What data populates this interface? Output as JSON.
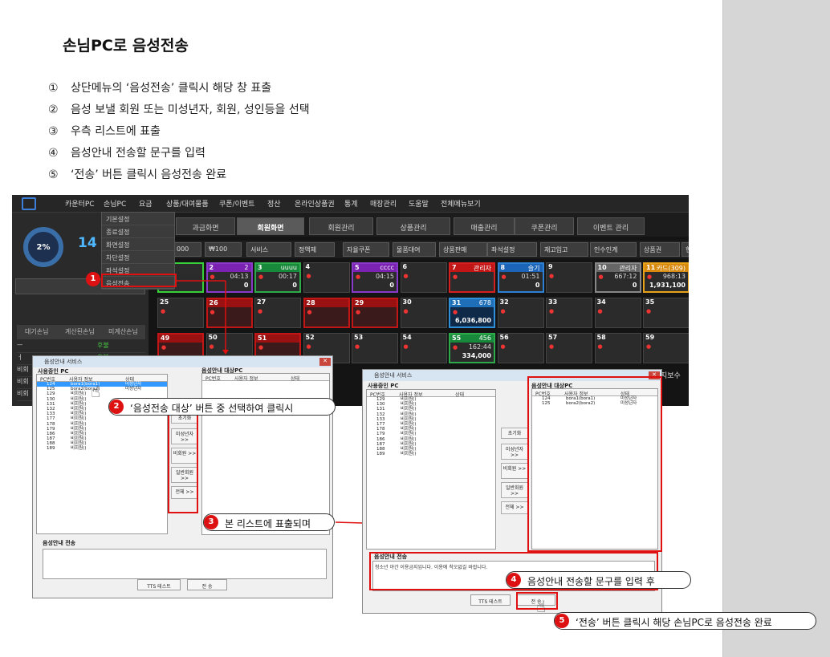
{
  "doc": {
    "title": "손님PC로 음성전송",
    "steps": [
      {
        "n": "①",
        "text": "상단메뉴의 ‘음성전송’ 클릭시 해당 창 표출"
      },
      {
        "n": "②",
        "text": "음성 보낼 회원 또는 미성년자, 회원, 성인등을 선택"
      },
      {
        "n": "③",
        "text": "우측 리스트에 표출"
      },
      {
        "n": "④",
        "text": "음성안내 전송할 문구를 입력"
      },
      {
        "n": "⑤",
        "text": "‘전송’ 버튼 클릭시 음성전송 완료"
      }
    ]
  },
  "app": {
    "menu": [
      "카운터PC",
      "손님PC",
      "요금",
      "상품/대여물품",
      "쿠폰/이벤트",
      "정산",
      "온라인상품권",
      "통계",
      "매장관리",
      "도움말",
      "전체메뉴보기"
    ],
    "submenu": [
      "기본설정",
      "종료설정",
      "화면설정",
      "차단설정",
      "좌석설정",
      "음성전송"
    ],
    "usage_percent": "2%",
    "seat_count": "14",
    "left_tabs": [
      "대기손님",
      "계산된손님",
      "미계산손님"
    ],
    "left_rows": [
      {
        "a": "ㅡ",
        "b": "후불"
      },
      {
        "a": "ㅓ",
        "b": "후불"
      },
      {
        "a": "비회",
        "b": "후불"
      },
      {
        "a": "비회",
        "b": "후불"
      },
      {
        "a": "비회",
        "b": ""
      }
    ],
    "top_tabs": [
      "과금화면",
      "회원화면",
      "회원관리",
      "상품관리",
      "매출관리",
      "쿠폰관리",
      "이벤트 관리"
    ],
    "tools": [
      "000",
      "₩100",
      "서비스",
      "정액제",
      "자율쿠폰",
      "물품대여",
      "상품판매",
      "좌석설정",
      "재고입고",
      "인수인계",
      "상품권",
      "현"
    ],
    "tiles": [
      {
        "num": "1",
        "name": "",
        "time": "",
        "big": "",
        "style": "green"
      },
      {
        "num": "2",
        "name": "2",
        "time": "04:13",
        "big": "0",
        "style": "purple"
      },
      {
        "num": "3",
        "name": "uuuu",
        "time": "00:17",
        "big": "0",
        "style": "green2"
      },
      {
        "num": "4",
        "name": "",
        "time": "",
        "big": "",
        "style": "plain"
      },
      {
        "num": "5",
        "name": "cccc",
        "time": "04:15",
        "big": "0",
        "style": "purple"
      },
      {
        "num": "6",
        "name": "",
        "time": "",
        "big": "",
        "style": "plain"
      },
      {
        "num": "7",
        "name": "관리자",
        "time": "",
        "big": "",
        "style": "red"
      },
      {
        "num": "8",
        "name": "슬기",
        "time": "01:51",
        "big": "0",
        "style": "blue"
      },
      {
        "num": "9",
        "name": "",
        "time": "",
        "big": "",
        "style": "plain"
      },
      {
        "num": "10",
        "name": "관리자",
        "time": "667:12",
        "big": "0",
        "style": "gray"
      },
      {
        "num": "11",
        "name": "카드(309)",
        "time": "968:13",
        "big": "1,931,100",
        "style": "orange"
      },
      {
        "num": "25",
        "name": "",
        "time": "",
        "big": "",
        "style": "plain"
      },
      {
        "num": "26",
        "name": "",
        "time": "",
        "big": "",
        "style": "redout"
      },
      {
        "num": "27",
        "name": "",
        "time": "",
        "big": "",
        "style": "plain"
      },
      {
        "num": "28",
        "name": "",
        "time": "",
        "big": "",
        "style": "redout"
      },
      {
        "num": "29",
        "name": "",
        "time": "",
        "big": "",
        "style": "redout"
      },
      {
        "num": "30",
        "name": "",
        "time": "",
        "big": "",
        "style": "plain"
      },
      {
        "num": "31",
        "name": "678",
        "time": "",
        "big": "6,036,800",
        "style": "cyan"
      },
      {
        "num": "32",
        "name": "",
        "time": "",
        "big": "",
        "style": "plain"
      },
      {
        "num": "33",
        "name": "",
        "time": "",
        "big": "",
        "style": "plain"
      },
      {
        "num": "34",
        "name": "",
        "time": "",
        "big": "",
        "style": "plain"
      },
      {
        "num": "35",
        "name": "",
        "time": "",
        "big": "",
        "style": "plain"
      },
      {
        "num": "49",
        "name": "",
        "time": "",
        "big": "",
        "style": "redout"
      },
      {
        "num": "50",
        "name": "",
        "time": "",
        "big": "",
        "style": "plain"
      },
      {
        "num": "51",
        "name": "",
        "time": "",
        "big": "",
        "style": "redout"
      },
      {
        "num": "52",
        "name": "",
        "time": "",
        "big": "",
        "style": "plain"
      },
      {
        "num": "53",
        "name": "",
        "time": "",
        "big": "",
        "style": "plain"
      },
      {
        "num": "54",
        "name": "",
        "time": "",
        "big": "",
        "style": "plain"
      },
      {
        "num": "55",
        "name": "456",
        "time": "162:44",
        "big": "334,000",
        "style": "green2"
      },
      {
        "num": "56",
        "name": "",
        "time": "",
        "big": "",
        "style": "plain"
      },
      {
        "num": "57",
        "name": "",
        "time": "",
        "big": "",
        "style": "plain"
      },
      {
        "num": "58",
        "name": "",
        "time": "",
        "big": "",
        "style": "plain"
      },
      {
        "num": "59",
        "name": "",
        "time": "",
        "big": "",
        "style": "plain"
      }
    ]
  },
  "dialog": {
    "title": "음성안내 서비스",
    "using_label": "사용중인 PC",
    "target_label": "음성안내 대상PC",
    "cols": [
      "PC번호",
      "사용자 정보",
      "상태"
    ],
    "btn_reset": "초기화",
    "btn_minor": "미성년자 >>",
    "btn_nonmember": "비회원 >>",
    "btn_general": "일반회원 >>",
    "btn_all": "전체 >>",
    "send_label": "음성안내 전송",
    "tts": "TTS 테스트",
    "send": "전 송",
    "memo_text": "청소년 야간 이용금지입니다. 이용에 착오없길 바랍니다."
  },
  "left_rows": [
    {
      "pc": "124",
      "user": "bora1(bora1)",
      "state": "미성년자",
      "sel": true
    },
    {
      "pc": "125",
      "user": "bora2(bora2)",
      "state": "미성년자",
      "sel": false
    },
    {
      "pc": "129",
      "user": "비회원()",
      "state": "",
      "sel": false
    },
    {
      "pc": "130",
      "user": "비회원()",
      "state": "",
      "sel": false
    },
    {
      "pc": "131",
      "user": "비회원()",
      "state": "",
      "sel": false
    },
    {
      "pc": "132",
      "user": "비회원()",
      "state": "",
      "sel": false
    },
    {
      "pc": "133",
      "user": "비회원()",
      "state": "",
      "sel": false
    },
    {
      "pc": "177",
      "user": "비회원()",
      "state": "",
      "sel": false
    },
    {
      "pc": "178",
      "user": "비회원()",
      "state": "",
      "sel": false
    },
    {
      "pc": "179",
      "user": "비회원()",
      "state": "",
      "sel": false
    },
    {
      "pc": "186",
      "user": "비회원()",
      "state": "",
      "sel": false
    },
    {
      "pc": "187",
      "user": "비회원()",
      "state": "",
      "sel": false
    },
    {
      "pc": "188",
      "user": "비회원()",
      "state": "",
      "sel": false
    },
    {
      "pc": "189",
      "user": "비회원()",
      "state": "",
      "sel": false
    }
  ],
  "right_left_rows": [
    {
      "pc": "129",
      "user": "비회원()",
      "state": "",
      "sel": false
    },
    {
      "pc": "130",
      "user": "비회원()",
      "state": "",
      "sel": false
    },
    {
      "pc": "131",
      "user": "비회원()",
      "state": "",
      "sel": false
    },
    {
      "pc": "132",
      "user": "비회원()",
      "state": "",
      "sel": false
    },
    {
      "pc": "133",
      "user": "비회원()",
      "state": "",
      "sel": false
    },
    {
      "pc": "177",
      "user": "비회원()",
      "state": "",
      "sel": false
    },
    {
      "pc": "178",
      "user": "비회원()",
      "state": "",
      "sel": false
    },
    {
      "pc": "179",
      "user": "비회원()",
      "state": "",
      "sel": false
    },
    {
      "pc": "186",
      "user": "비회원()",
      "state": "",
      "sel": false
    },
    {
      "pc": "187",
      "user": "비회원()",
      "state": "",
      "sel": false
    },
    {
      "pc": "188",
      "user": "비회원()",
      "state": "",
      "sel": false
    },
    {
      "pc": "189",
      "user": "비회원()",
      "state": "",
      "sel": false
    }
  ],
  "target_rows": [
    {
      "pc": "124",
      "user": "bora1(bora1)",
      "state": "미성년자",
      "sel": false
    },
    {
      "pc": "125",
      "user": "bora2(bora2)",
      "state": "미성년자",
      "sel": false
    }
  ],
  "callouts": [
    {
      "n": "1",
      "text": ""
    },
    {
      "n": "2",
      "text": "‘음성전송 대상’ 버튼 중 선택하여 클릭시"
    },
    {
      "n": "3",
      "text": "본 리스트에 표출되며"
    },
    {
      "n": "4",
      "text": "음성안내 전송할 문구를 입력 후"
    },
    {
      "n": "5",
      "text": "‘전송’ 버튼 클릭시 해당 손님PC로 음성전송 완료"
    }
  ],
  "app_side_text": "지보수"
}
